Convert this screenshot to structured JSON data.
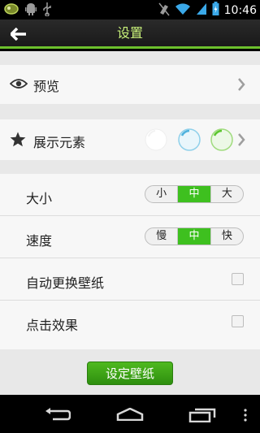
{
  "status_bar": {
    "time": "10:46",
    "left_icons": [
      "app-icon",
      "android-icon",
      "usb-icon"
    ],
    "right_icons": [
      "mute-icon",
      "wifi-icon",
      "signal-icon",
      "battery-icon"
    ]
  },
  "header": {
    "title": "设置"
  },
  "rows": {
    "preview": {
      "label": "预览"
    },
    "elements": {
      "label": "展示元素"
    },
    "size": {
      "label": "大小",
      "options": [
        "小",
        "中",
        "大"
      ],
      "selected": "中"
    },
    "speed": {
      "label": "速度",
      "options": [
        "慢",
        "中",
        "快"
      ],
      "selected": "中"
    },
    "auto_wallpaper": {
      "label": "自动更换壁纸",
      "checked": false
    },
    "click_effect": {
      "label": "点击效果",
      "checked": false
    }
  },
  "button": {
    "label": "设定壁纸"
  },
  "colors": {
    "accent": "#6dc12d",
    "title": "#c9f27a",
    "selected": "#3ec01f"
  }
}
